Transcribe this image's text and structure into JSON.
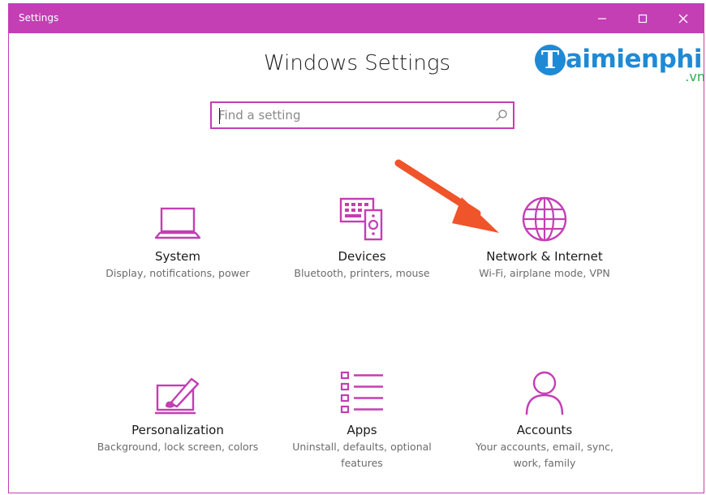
{
  "window": {
    "title": "Settings"
  },
  "header": {
    "title": "Windows Settings"
  },
  "watermark": {
    "brand": "aimienphi",
    "initial": "T",
    "suffix": ".vn"
  },
  "search": {
    "placeholder": "Find a setting",
    "value": ""
  },
  "colors": {
    "accent": "#c43eb4",
    "arrow": "#f0542a",
    "brand": "#1e8ad6"
  },
  "tiles": [
    {
      "name": "System",
      "desc": "Display, notifications, power",
      "icon": "laptop-icon"
    },
    {
      "name": "Devices",
      "desc": "Bluetooth, printers, mouse",
      "icon": "devices-icon"
    },
    {
      "name": "Network & Internet",
      "desc": "Wi-Fi, airplane mode, VPN",
      "icon": "globe-icon"
    },
    {
      "name": "Personalization",
      "desc": "Background, lock screen, colors",
      "icon": "paint-icon"
    },
    {
      "name": "Apps",
      "desc": "Uninstall, defaults, optional features",
      "icon": "apps-list-icon"
    },
    {
      "name": "Accounts",
      "desc": "Your accounts, email, sync, work, family",
      "icon": "person-icon"
    }
  ]
}
